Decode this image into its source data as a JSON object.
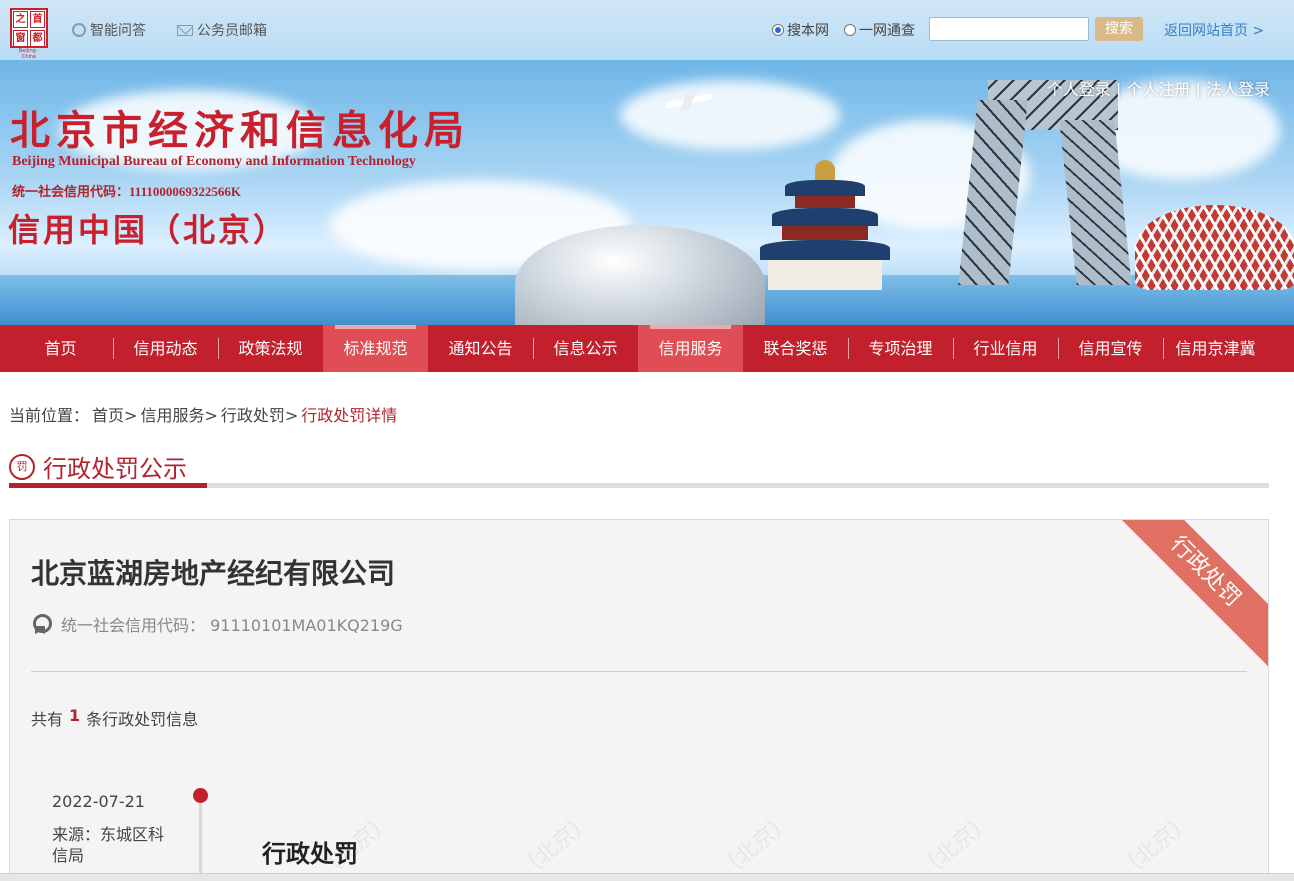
{
  "header": {
    "logo_chars": [
      "之",
      "首",
      "窗",
      "都"
    ],
    "logo_small": "Beijing · China",
    "qa_label": "智能问答",
    "mail_label": "公务员邮箱",
    "scope_options": [
      "搜本网",
      "一网通查"
    ],
    "scope_selected": "搜本网",
    "search_value": "",
    "search_button": "搜索",
    "home_link": "返回网站首页 >"
  },
  "banner": {
    "title": "北京市经济和信息化局",
    "title_en": "Beijing Municipal Bureau of Economy and Information Technology",
    "credit_code": "统一社会信用代码：1111000069322566K",
    "subtitle": "信用中国（北京）",
    "auth_personal_login": "个人登录",
    "auth_personal_register": "个人注册",
    "auth_legal_login": "法人登录",
    "auth_sep": "|"
  },
  "nav": {
    "items": [
      "首页",
      "信用动态",
      "政策法规",
      "标准规范",
      "通知公告",
      "信息公示",
      "信用服务",
      "联合奖惩",
      "专项治理",
      "行业信用",
      "信用宣传",
      "信用京津冀"
    ],
    "highlighted": [
      "标准规范",
      "信用服务"
    ]
  },
  "breadcrumb": {
    "prefix": "当前位置：",
    "items": [
      "首页>",
      "信用服务>",
      "行政处罚>"
    ],
    "current": "行政处罚详情"
  },
  "section": {
    "icon_char": "罚",
    "title": "行政处罚公示"
  },
  "card": {
    "ribbon": "行政处罚",
    "company": "北京蓝湖房地产经纪有限公司",
    "credit_label": "统一社会信用代码：",
    "credit_value": "91110101MA01KQ219G",
    "count_prefix": "共有",
    "count": "1",
    "count_suffix": "条行政处罚信息",
    "record": {
      "date": "2022-07-21",
      "source": "来源：东城区科信局",
      "title": "行政处罚"
    },
    "watermark_text": "（北京）"
  },
  "colors": {
    "brand_red": "#c1202c",
    "nav_highlight": "#df4d55",
    "ribbon": "#e07062",
    "link_blue": "#3a7fc4"
  }
}
